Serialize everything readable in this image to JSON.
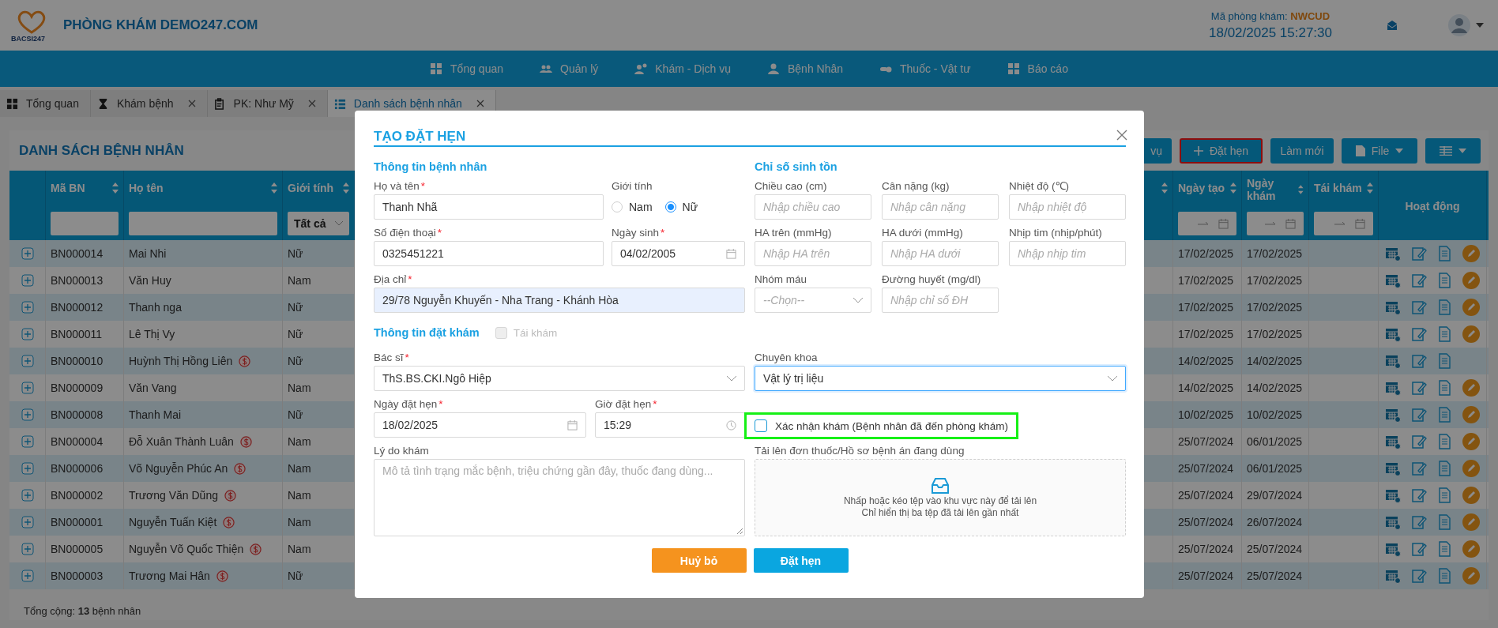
{
  "header": {
    "logo_text": "BACSI247",
    "title": "PHÒNG KHÁM DEMO247.COM",
    "clinic_code_label": "Mã phòng khám:",
    "clinic_code": "NWCUD",
    "datetime": "18/02/2025 15:27:30"
  },
  "nav": [
    {
      "label": "Tổng quan"
    },
    {
      "label": "Quản lý"
    },
    {
      "label": "Khám - Dịch vụ"
    },
    {
      "label": "Bệnh Nhân"
    },
    {
      "label": "Thuốc - Vật tư"
    },
    {
      "label": "Báo cáo"
    }
  ],
  "tabs": [
    {
      "label": "Tổng quan",
      "selected": false,
      "closable": false
    },
    {
      "label": "Khám bệnh",
      "selected": false,
      "closable": true
    },
    {
      "label": "PK: Như Mỹ",
      "selected": false,
      "closable": true
    },
    {
      "label": "Danh sách bệnh nhân",
      "selected": true,
      "closable": true
    }
  ],
  "page": {
    "title": "DANH SÁCH BỆNH NHÂN",
    "toolbar": [
      {
        "label": "vụ",
        "kind": "plain",
        "highlighted": false
      },
      {
        "label": "Đặt hẹn",
        "kind": "add",
        "highlighted": true
      },
      {
        "label": "Làm mới",
        "kind": "plain",
        "highlighted": false
      },
      {
        "label": "File",
        "kind": "file",
        "highlighted": false
      },
      {
        "kind": "columns",
        "highlighted": false
      }
    ]
  },
  "table": {
    "columns": [
      {
        "label": "Mã BN",
        "sortable": true,
        "kind": "text"
      },
      {
        "label": "Họ tên",
        "sortable": true,
        "kind": "text"
      },
      {
        "label": "Giới tính",
        "sortable": true,
        "kind": "select",
        "filter_value": "Tất cả"
      },
      {
        "label": "Ngày tạo",
        "sortable": true,
        "kind": "daterange"
      },
      {
        "label": "Ngày khám",
        "sortable": true,
        "kind": "daterange"
      },
      {
        "label": "Tái khám",
        "sortable": true,
        "kind": "daterange"
      },
      {
        "label": "Hoạt động",
        "sortable": false,
        "kind": "plain"
      }
    ],
    "rows": [
      {
        "code": "BN000014",
        "name": "Mai Nhi",
        "debt": false,
        "gender": "Nữ",
        "created": "17/02/2025",
        "exam_date": "17/02/2025",
        "editable": true
      },
      {
        "code": "BN000013",
        "name": "Văn Huy",
        "debt": false,
        "gender": "Nam",
        "created": "17/02/2025",
        "exam_date": "17/02/2025",
        "editable": true
      },
      {
        "code": "BN000012",
        "name": "Thanh nga",
        "debt": false,
        "gender": "Nữ",
        "created": "17/02/2025",
        "exam_date": "17/02/2025",
        "editable": true
      },
      {
        "code": "BN000011",
        "name": "Lê Thị Vy",
        "debt": false,
        "gender": "Nữ",
        "created": "17/02/2025",
        "exam_date": "17/02/2025",
        "editable": true
      },
      {
        "code": "BN000010",
        "name": "Huỳnh Thị Hồng Liên",
        "debt": true,
        "gender": "Nữ",
        "created": "14/02/2025",
        "exam_date": "14/02/2025",
        "editable": false
      },
      {
        "code": "BN000009",
        "name": "Văn Vang",
        "debt": false,
        "gender": "Nam",
        "created": "14/02/2025",
        "exam_date": "14/02/2025",
        "editable": true
      },
      {
        "code": "BN000008",
        "name": "Thanh Mai",
        "debt": false,
        "gender": "Nữ",
        "created": "10/02/2025",
        "exam_date": "10/02/2025",
        "editable": true
      },
      {
        "code": "BN000004",
        "name": "Đỗ Xuân Thành Luân",
        "debt": true,
        "gender": "Nam",
        "created": "25/07/2024",
        "exam_date": "06/01/2025",
        "editable": true
      },
      {
        "code": "BN000006",
        "name": "Võ Nguyễn Phúc An",
        "debt": true,
        "gender": "Nam",
        "created": "25/07/2024",
        "exam_date": "06/01/2025",
        "editable": true
      },
      {
        "code": "BN000002",
        "name": "Trương Văn Dũng",
        "debt": true,
        "gender": "Nam",
        "created": "25/07/2024",
        "exam_date": "29/07/2024",
        "editable": true
      },
      {
        "code": "BN000001",
        "name": "Nguyễn Tuấn Kiệt",
        "debt": true,
        "gender": "Nam",
        "created": "25/07/2024",
        "exam_date": "26/07/2024",
        "editable": true
      },
      {
        "code": "BN000005",
        "name": "Nguyễn Võ Quốc Thiện",
        "debt": true,
        "gender": "Nam",
        "created": "25/07/2024",
        "exam_date": "25/07/2024",
        "editable": true
      },
      {
        "code": "BN000003",
        "name": "Trương Mai Hân",
        "debt": true,
        "gender": "Nữ",
        "created": "25/07/2024",
        "exam_date": "25/07/2024",
        "editable": true
      }
    ],
    "footer": "Tổng cộng: **13** bệnh nhân"
  },
  "modal": {
    "title": "TẠO ĐẶT HẸN",
    "patient": {
      "heading": "Thông tin bệnh nhân",
      "name": {
        "label": "Họ và tên",
        "mark": "*",
        "value": "Thanh Nhã"
      },
      "gender": {
        "label": "Giới tính",
        "options": [
          {
            "label": "Nam",
            "selected": false
          },
          {
            "label": "Nữ",
            "selected": true
          }
        ]
      },
      "phone": {
        "label": "Số điện thoại",
        "mark": "*",
        "value": "0325451221"
      },
      "birthdate": {
        "label": "Ngày sinh",
        "mark": "*",
        "value": "04/02/2005"
      },
      "address": {
        "label": "Địa chỉ",
        "mark": "*",
        "value": "29/78 Nguyễn Khuyến - Nha Trang - Khánh Hòa",
        "autofilled": true
      }
    },
    "vitals": {
      "heading": "Chỉ số sinh tồn",
      "fields": [
        {
          "label": "Chiều cao (cm)",
          "placeholder": "Nhập chiều cao",
          "kind": "input"
        },
        {
          "label": "Cân nặng (kg)",
          "placeholder": "Nhập cân nặng",
          "kind": "input"
        },
        {
          "label": "Nhiệt độ (℃)",
          "placeholder": "Nhập nhiệt độ",
          "kind": "input"
        },
        {
          "label": "HA trên (mmHg)",
          "placeholder": "Nhập HA trên",
          "kind": "input"
        },
        {
          "label": "HA dưới (mmHg)",
          "placeholder": "Nhập HA dưới",
          "kind": "input"
        },
        {
          "label": "Nhịp tim (nhịp/phút)",
          "placeholder": "Nhập nhịp tim",
          "kind": "input"
        },
        {
          "label": "Nhóm máu",
          "placeholder": "--Chọn--",
          "kind": "select"
        },
        {
          "label": "Đường huyết (mg/dl)",
          "placeholder": "Nhập chỉ số ĐH",
          "kind": "input"
        }
      ]
    },
    "booking": {
      "heading": "Thông tin đặt khám",
      "revisit": {
        "label": "Tái khám",
        "checked": false,
        "disabled": true
      },
      "doctor": {
        "label": "Bác sĩ",
        "mark": "*",
        "value": "ThS.BS.CKI.Ngô Hiệp"
      },
      "specialty": {
        "label": "Chuyên khoa",
        "value": "Vật lý trị liệu",
        "focused": true
      },
      "date": {
        "label": "Ngày đặt hẹn",
        "mark": "*",
        "value": "18/02/2025"
      },
      "time": {
        "label": "Giờ đặt hẹn",
        "mark": "*",
        "value": "15:29"
      },
      "confirm": {
        "label": "Xác nhận khám (Bệnh nhân đã đến phòng khám)",
        "checked": false,
        "highlighted": true
      },
      "reason": {
        "label": "Lý do khám",
        "placeholder": "Mô tả tình trạng mắc bệnh, triệu chứng gần đây, thuốc đang dùng..."
      },
      "upload": {
        "label": "Tải lên đơn thuốc/Hồ sơ bệnh án đang dùng",
        "hint": "Nhấp hoặc kéo tệp vào khu vực này để tải lên",
        "note": "Chỉ hiển thị ba tệp đã tải lên gần nhất"
      }
    },
    "buttons": [
      {
        "label": "Huỷ bỏ",
        "kind": "cancel"
      },
      {
        "label": "Đặt hẹn",
        "kind": "submit"
      }
    ]
  }
}
